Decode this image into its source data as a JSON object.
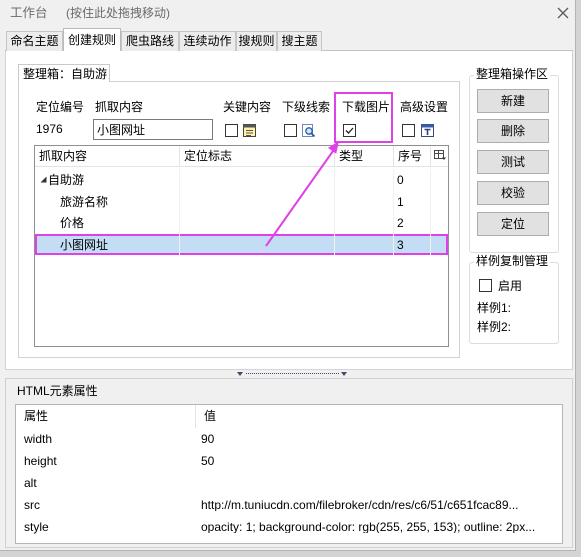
{
  "window": {
    "title": "工作台",
    "drag_hint": "(按住此处拖拽移动)",
    "close_icon": "close-icon"
  },
  "tabs": [
    {
      "label": "命名主题",
      "selected": false
    },
    {
      "label": "创建规则",
      "selected": true
    },
    {
      "label": "爬虫路线",
      "selected": false
    },
    {
      "label": "连续动作",
      "selected": false
    },
    {
      "label": "搜规则",
      "selected": false
    },
    {
      "label": "搜主题",
      "selected": false
    }
  ],
  "box": {
    "tab_label": "整理箱：自助游",
    "position_id": {
      "label": "定位编号",
      "value": "1976"
    },
    "content": {
      "label": "抓取内容",
      "value": "小图网址"
    },
    "options": [
      {
        "label": "关键内容",
        "checked": false,
        "icon": "key-content-icon"
      },
      {
        "label": "下级线索",
        "checked": false,
        "icon": "sub-clue-icon"
      },
      {
        "label": "下载图片",
        "checked": true,
        "highlighted": true
      },
      {
        "label": "高级设置",
        "checked": false,
        "icon": "advanced-settings-icon"
      }
    ]
  },
  "grid": {
    "columns": {
      "content": "抓取内容",
      "marker": "定位标志",
      "type": "类型",
      "index": "序号"
    },
    "header_icon": "column-chooser-icon",
    "root": {
      "name": "自助游",
      "index": "0",
      "expanded": true
    },
    "children": [
      {
        "name": "旅游名称",
        "index": "1",
        "selected": false
      },
      {
        "name": "价格",
        "index": "2",
        "selected": false
      },
      {
        "name": "小图网址",
        "index": "3",
        "selected": true,
        "highlighted": true
      }
    ]
  },
  "ops": {
    "title": "整理箱操作区",
    "buttons": {
      "new": "新建",
      "delete": "删除",
      "test": "测试",
      "verify": "校验",
      "locate": "定位"
    }
  },
  "sample_copy": {
    "title": "样例复制管理",
    "enable": {
      "label": "启用",
      "checked": false
    },
    "sample1_label": "样例1:",
    "sample2_label": "样例2:"
  },
  "html_attributes": {
    "title": "HTML元素属性",
    "columns": {
      "attribute": "属性",
      "value": "值"
    },
    "rows": [
      {
        "attribute": "width",
        "value": "90"
      },
      {
        "attribute": "height",
        "value": "50"
      },
      {
        "attribute": "alt",
        "value": ""
      },
      {
        "attribute": "src",
        "value": "http://m.tuniucdn.com/filebroker/cdn/res/c6/51/c651fcac89..."
      },
      {
        "attribute": "style",
        "value": "opacity: 1; background-color: rgb(255, 255, 153); outline: 2px..."
      }
    ]
  },
  "colors": {
    "annotation": "#e040e8",
    "selection": "#c3ddf5",
    "window_bg": "#f0f0f0"
  }
}
